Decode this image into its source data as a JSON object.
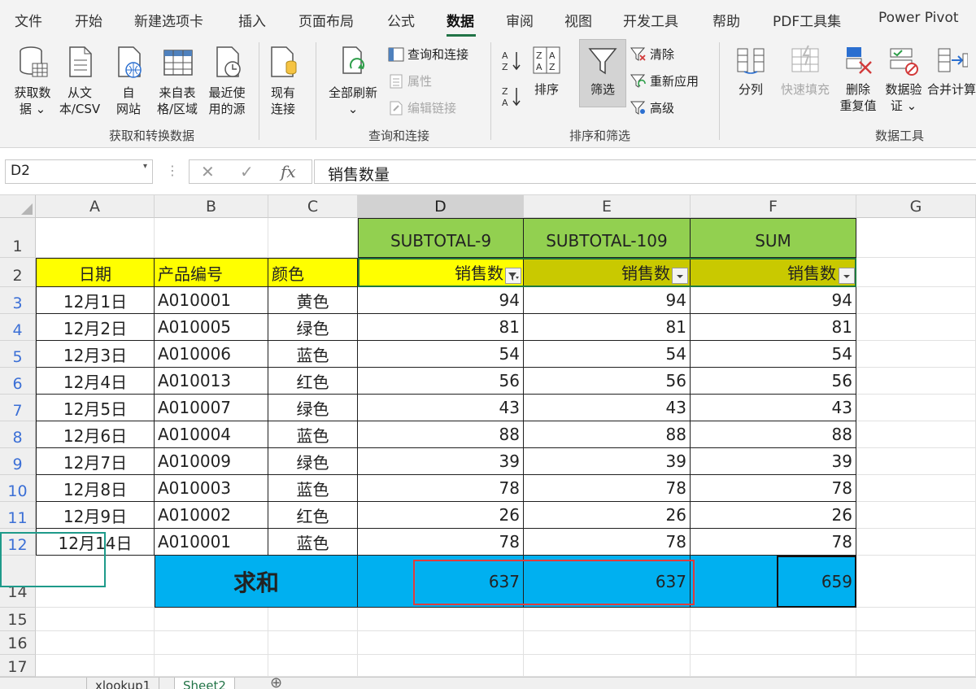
{
  "tabs": [
    "文件",
    "开始",
    "新建选项卡",
    "插入",
    "页面布局",
    "公式",
    "数据",
    "审阅",
    "视图",
    "开发工具",
    "帮助",
    "PDF工具集",
    "Power Pivot"
  ],
  "active_tab": "数据",
  "ribbon": {
    "get_data": {
      "l1": "获取数",
      "l2": "据 ⌄"
    },
    "from_text": {
      "l1": "从文",
      "l2": "本/CSV"
    },
    "from_web": {
      "l1": "自",
      "l2": "网站"
    },
    "from_table": {
      "l1": "来自表",
      "l2": "格/区域"
    },
    "recent": {
      "l1": "最近使",
      "l2": "用的源"
    },
    "existing": {
      "l1": "现有",
      "l2": "连接"
    },
    "group1": "获取和转换数据",
    "refresh_all": {
      "l1": "全部刷新",
      "l2": "⌄"
    },
    "queries": "查询和连接",
    "properties": "属性",
    "edit_links": "编辑链接",
    "group2": "查询和连接",
    "sort": "排序",
    "filter": "筛选",
    "clear": "清除",
    "reapply": "重新应用",
    "advanced": "高级",
    "group3": "排序和筛选",
    "split": "分列",
    "flash_fill": "快速填充",
    "remove_dup": {
      "l1": "删除",
      "l2": "重复值"
    },
    "validation": {
      "l1": "数据验",
      "l2": "证 ⌄"
    },
    "consolidate": "合并计算",
    "group4": "数据工具"
  },
  "formula_bar": {
    "name_box": "D2",
    "formula": "销售数量"
  },
  "columns": [
    "A",
    "B",
    "C",
    "D",
    "E",
    "F",
    "G"
  ],
  "header_row1": {
    "d": "SUBTOTAL-9",
    "e": "SUBTOTAL-109",
    "f": "SUM"
  },
  "header_row2": {
    "a": "日期",
    "b": "产品编号",
    "c": "颜色",
    "d": "销售数",
    "e": "销售数",
    "f": "销售数"
  },
  "rows": [
    {
      "rn": "3",
      "date": "12月1日",
      "code": "A010001",
      "color": "黄色",
      "d": "94",
      "e": "94",
      "f": "94"
    },
    {
      "rn": "4",
      "date": "12月2日",
      "code": "A010005",
      "color": "绿色",
      "d": "81",
      "e": "81",
      "f": "81"
    },
    {
      "rn": "5",
      "date": "12月3日",
      "code": "A010006",
      "color": "蓝色",
      "d": "54",
      "e": "54",
      "f": "54"
    },
    {
      "rn": "6",
      "date": "12月4日",
      "code": "A010013",
      "color": "红色",
      "d": "56",
      "e": "56",
      "f": "56"
    },
    {
      "rn": "7",
      "date": "12月5日",
      "code": "A010007",
      "color": "绿色",
      "d": "43",
      "e": "43",
      "f": "43"
    },
    {
      "rn": "8",
      "date": "12月6日",
      "code": "A010004",
      "color": "蓝色",
      "d": "88",
      "e": "88",
      "f": "88"
    },
    {
      "rn": "9",
      "date": "12月7日",
      "code": "A010009",
      "color": "绿色",
      "d": "39",
      "e": "39",
      "f": "39"
    },
    {
      "rn": "10",
      "date": "12月8日",
      "code": "A010003",
      "color": "蓝色",
      "d": "78",
      "e": "78",
      "f": "78"
    },
    {
      "rn": "11",
      "date": "12月9日",
      "code": "A010002",
      "color": "红色",
      "d": "26",
      "e": "26",
      "f": "26"
    },
    {
      "rn": "12",
      "date": "12月14日",
      "code": "A010001",
      "color": "蓝色",
      "d": "78",
      "e": "78",
      "f": "78"
    }
  ],
  "total": {
    "label": "求和",
    "d": "637",
    "e": "637",
    "f": "659"
  },
  "row_numbers": {
    "r1": "1",
    "r2": "2",
    "r14": "14",
    "r15": "15",
    "r16": "16",
    "r17": "17"
  },
  "sheets": [
    "xlookup1",
    "Sheet2"
  ],
  "active_sheet": "Sheet2",
  "colors": {
    "header_green": "#92d050",
    "header_yellow": "#ffff00",
    "filtered_olive": "#c9c900",
    "total_cyan": "#00b0f0",
    "accent": "#217346"
  }
}
